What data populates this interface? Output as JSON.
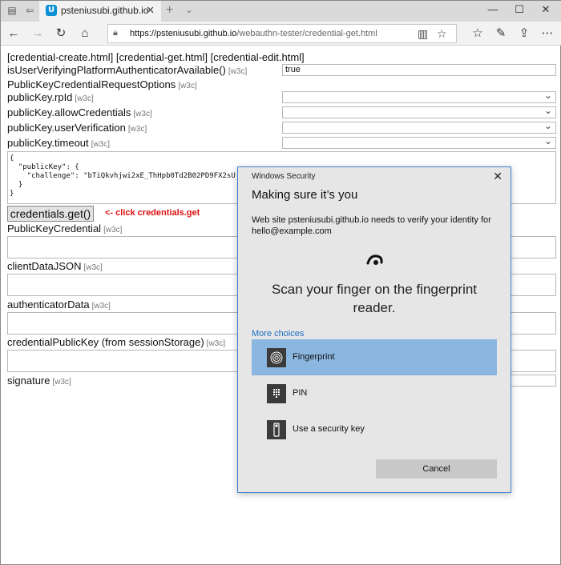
{
  "browser": {
    "tab_title": "psteniusubi.github.io",
    "url_host": "https://psteniusubi.github.io",
    "url_path": "/webauthn-tester/credential-get.html"
  },
  "page": {
    "links": "[credential-create.html] [credential-get.html] [credential-edit.html]",
    "w3c": "[w3c]",
    "uvpa_label": "isUserVerifyingPlatformAuthenticatorAvailable()",
    "uvpa_value": "true",
    "options_label": "PublicKeyCredentialRequestOptions",
    "rpid_label": "publicKey.rpId",
    "allow_label": "publicKey.allowCredentials",
    "uv_label": "publicKey.userVerification",
    "timeout_label": "publicKey.timeout",
    "code": "{\n  \"publicKey\": {\n    \"challenge\": \"bTiQkvhjwi2xE_ThHpb0Td2B02PD9FX2sU\n  }\n}",
    "get_button": "credentials.get()",
    "hint": "<- click credentials.get",
    "credential_label": "PublicKeyCredential",
    "client_label": "clientDataJSON",
    "authdata_label": "authenticatorData",
    "pubkey_label": "credentialPublicKey (from sessionStorage)",
    "signature_label": "signature"
  },
  "dialog": {
    "caption": "Windows Security",
    "title": "Making sure it’s you",
    "message": "Web site psteniusubi.github.io needs to verify your identity for hello@example.com",
    "scan": "Scan your finger on the fingerprint reader.",
    "more_choices": "More choices",
    "choices": [
      {
        "label": "Fingerprint",
        "icon": "fingerprint-icon",
        "selected": true
      },
      {
        "label": "PIN",
        "icon": "keypad-icon",
        "selected": false
      },
      {
        "label": "Use a security key",
        "icon": "security-key-icon",
        "selected": false
      }
    ],
    "cancel": "Cancel"
  },
  "colors": {
    "accent": "#3c7fd0",
    "selected_choice": "#8ab6e0",
    "hint_red": "#d11111",
    "link_blue": "#1a6dc2"
  }
}
